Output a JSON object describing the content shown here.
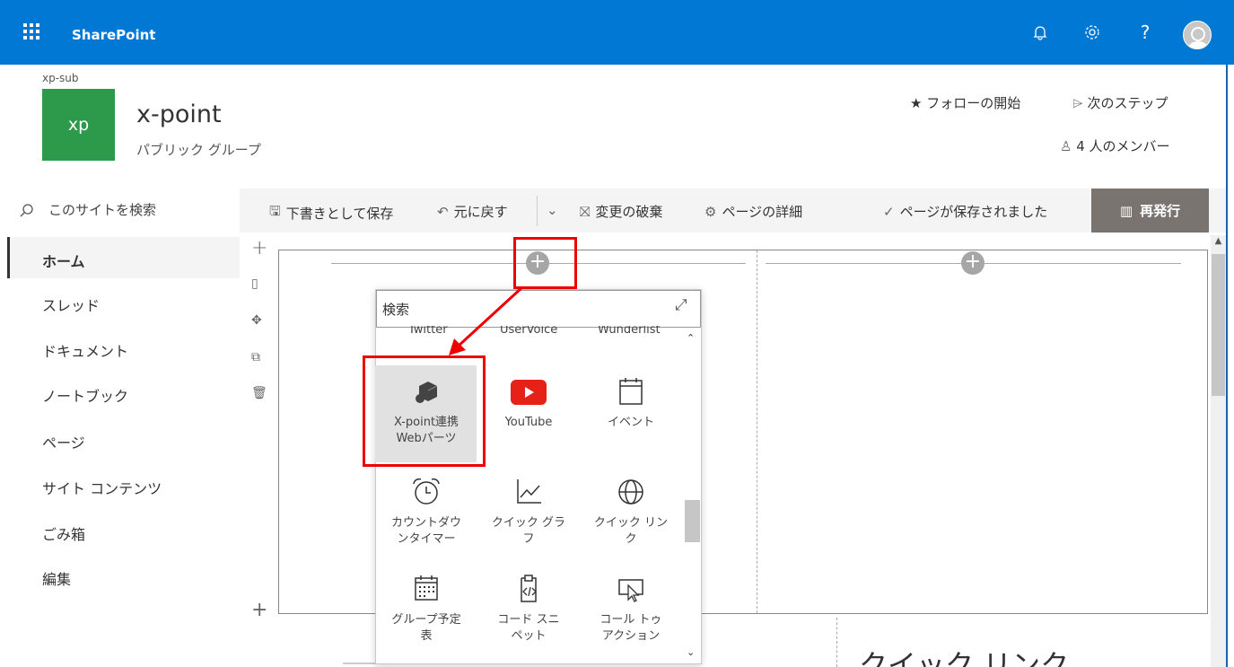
{
  "suite": {
    "brand": "SharePoint",
    "icons": [
      "waffle-icon",
      "bell-icon",
      "gear-icon",
      "help-icon",
      "avatar"
    ],
    "help_glyph": "?"
  },
  "site": {
    "crumb": "xp-sub",
    "logo_text": "xp",
    "title": "x-point",
    "subtitle": "パブリック グループ",
    "follow": "フォローの開始",
    "next_steps": "次のステップ",
    "members": "4 人のメンバー"
  },
  "search": {
    "placeholder": "このサイトを検索"
  },
  "commandbar": {
    "save_draft": "下書きとして保存",
    "undo": "元に戻す",
    "discard": "変更の破棄",
    "page_details": "ページの詳細",
    "saved_status": "ページが保存されました",
    "republish": "再発行"
  },
  "leftnav": {
    "items": [
      "ホーム",
      "スレッド",
      "ドキュメント",
      "ノートブック",
      "ページ",
      "サイト コンテンツ",
      "ごみ箱",
      "編集"
    ]
  },
  "toolbox": {
    "search_value": "検索",
    "top_row": [
      "Twitter",
      "UserVoice",
      "Wunderlist"
    ],
    "tiles": [
      {
        "label": "X-point連携\nWebパーツ",
        "icon": "cube-icon"
      },
      {
        "label": "YouTube",
        "icon": "youtube-icon"
      },
      {
        "label": "イベント",
        "icon": "calendar-icon"
      },
      {
        "label": "カウントダウ\nンタイマー",
        "icon": "alarm-clock-icon"
      },
      {
        "label": "クイック グラ\nフ",
        "icon": "chart-icon"
      },
      {
        "label": "クイック リン\nク",
        "icon": "globe-icon"
      },
      {
        "label": "グループ予定\n表",
        "icon": "group-calendar-icon"
      },
      {
        "label": "コード スニ\nペット",
        "icon": "code-snippet-icon"
      },
      {
        "label": "コール トゥ\nアクション",
        "icon": "call-to-action-icon"
      }
    ]
  },
  "canvas": {
    "lower_heading": "クイック リンク"
  },
  "colors": {
    "suitebar": "#0078d4",
    "site_logo": "#2c9a4a",
    "republish": "#7a7471",
    "annotation": "#e00000",
    "youtube": "#e62117"
  }
}
